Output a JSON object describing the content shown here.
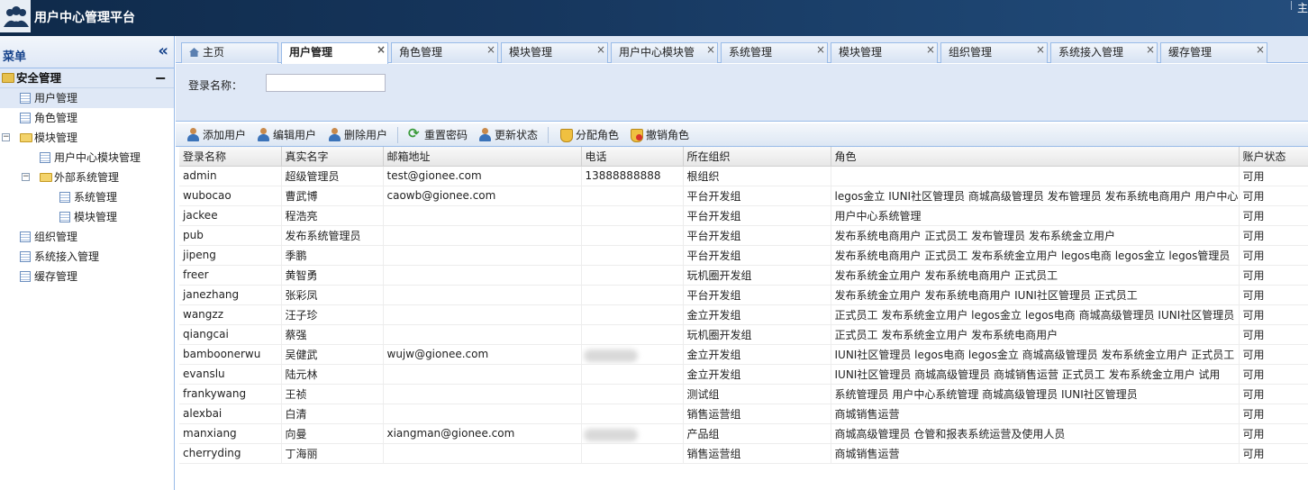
{
  "header": {
    "title": "用户中心管理平台",
    "right_text": "主"
  },
  "sidebar": {
    "title": "菜单",
    "section": "安全管理",
    "items": [
      {
        "label": "用户管理"
      },
      {
        "label": "角色管理"
      },
      {
        "label": "模块管理"
      },
      {
        "label": "用户中心模块管理"
      },
      {
        "label": "外部系统管理"
      },
      {
        "label": "系统管理"
      },
      {
        "label": "模块管理"
      },
      {
        "label": "组织管理"
      },
      {
        "label": "系统接入管理"
      },
      {
        "label": "缓存管理"
      }
    ]
  },
  "tabs": [
    {
      "label": "主页"
    },
    {
      "label": "用户管理"
    },
    {
      "label": "角色管理"
    },
    {
      "label": "模块管理"
    },
    {
      "label": "用户中心模块管"
    },
    {
      "label": "系统管理"
    },
    {
      "label": "模块管理"
    },
    {
      "label": "组织管理"
    },
    {
      "label": "系统接入管理"
    },
    {
      "label": "缓存管理"
    }
  ],
  "search": {
    "label": "登录名称：",
    "value": ""
  },
  "toolbar": {
    "add_user": "添加用户",
    "edit_user": "编辑用户",
    "delete_user": "删除用户",
    "reset_password": "重置密码",
    "update_status": "更新状态",
    "assign_role": "分配角色",
    "revoke_role": "撤销角色"
  },
  "table": {
    "columns": [
      "登录名称",
      "真实名字",
      "邮箱地址",
      "电话",
      "所在组织",
      "角色",
      "账户状态"
    ],
    "rows": [
      [
        "admin",
        "超级管理员",
        "test@gionee.com",
        "13888888888",
        "根组织",
        "",
        "可用"
      ],
      [
        "wubocao",
        "曹武博",
        "caowb@gionee.com",
        "",
        "平台开发组",
        "legos金立  IUNI社区管理员  商城高级管理员  发布管理员  发布系统电商用户  用户中心系统管理",
        "可用"
      ],
      [
        "jackee",
        "程浩亮",
        "",
        "",
        "平台开发组",
        "用户中心系统管理",
        "可用"
      ],
      [
        "pub",
        "发布系统管理员",
        "",
        "",
        "平台开发组",
        "发布系统电商用户  正式员工  发布管理员  发布系统金立用户",
        "可用"
      ],
      [
        "jipeng",
        "季鹏",
        "",
        "",
        "平台开发组",
        "发布系统电商用户  正式员工  发布系统金立用户  legos电商  legos金立  legos管理员",
        "可用"
      ],
      [
        "freer",
        "黄智勇",
        "",
        "",
        "玩机圈开发组",
        "发布系统金立用户  发布系统电商用户  正式员工",
        "可用"
      ],
      [
        "janezhang",
        "张彩凤",
        "",
        "",
        "平台开发组",
        "发布系统金立用户  发布系统电商用户  IUNI社区管理员  正式员工",
        "可用"
      ],
      [
        "wangzz",
        "汪子珍",
        "",
        "",
        "金立开发组",
        "正式员工  发布系统金立用户  legos金立  legos电商  商城高级管理员  IUNI社区管理员",
        "可用"
      ],
      [
        "qiangcai",
        "蔡强",
        "",
        "",
        "玩机圈开发组",
        "正式员工  发布系统金立用户  发布系统电商用户",
        "可用"
      ],
      [
        "bamboonerwu",
        "吴健武",
        "wujw@gionee.com",
        "",
        "金立开发组",
        "IUNI社区管理员  legos电商  legos金立  商城高级管理员  发布系统金立用户  正式员工",
        "可用"
      ],
      [
        "evanslu",
        "陆元林",
        "",
        "",
        "金立开发组",
        "IUNI社区管理员  商城高级管理员  商城销售运营  正式员工  发布系统金立用户  试用",
        "可用"
      ],
      [
        "frankywang",
        "王祯",
        "",
        "",
        "测试组",
        "系统管理员  用户中心系统管理  商城高级管理员  IUNI社区管理员",
        "可用"
      ],
      [
        "alexbai",
        "白清",
        "",
        "",
        "销售运营组",
        "商城销售运营",
        "可用"
      ],
      [
        "manxiang",
        "向曼",
        "xiangman@gionee.com",
        "",
        "产品组",
        "商城高级管理员  仓管和报表系统运营及使用人员",
        "可用"
      ],
      [
        "cherryding",
        "丁海丽",
        "",
        "",
        "销售运营组",
        "商城销售运营",
        "可用"
      ]
    ]
  },
  "colors": {
    "header_bg": "#16365d",
    "panel_bg": "#dfe8f6",
    "border": "#99bbe8"
  }
}
